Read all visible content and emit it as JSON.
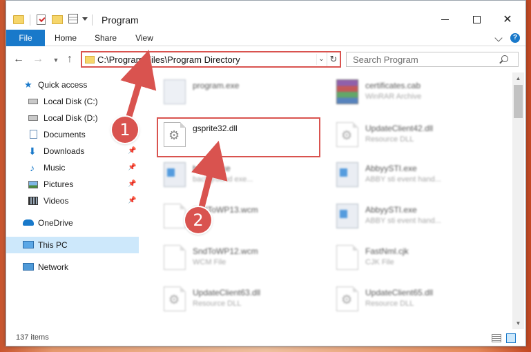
{
  "window": {
    "title": "Program"
  },
  "ribbon": {
    "tabs": [
      "File",
      "Home",
      "Share",
      "View"
    ],
    "help": "?"
  },
  "nav": {
    "address_path": "C:\\Program Files\\Program Directory",
    "search_placeholder": "Search Program"
  },
  "sidebar": {
    "items": [
      {
        "label": "Quick access",
        "icon": "star-icon",
        "pinned": false
      },
      {
        "label": "Local Disk (C:)",
        "icon": "drive-icon",
        "pinned": false
      },
      {
        "label": "Local Disk (D:)",
        "icon": "drive-icon",
        "pinned": false
      },
      {
        "label": "Documents",
        "icon": "documents-icon",
        "pinned": true
      },
      {
        "label": "Downloads",
        "icon": "download-icon",
        "pinned": true
      },
      {
        "label": "Music",
        "icon": "music-icon",
        "pinned": true
      },
      {
        "label": "Pictures",
        "icon": "pictures-icon",
        "pinned": true
      },
      {
        "label": "Videos",
        "icon": "videos-icon",
        "pinned": true
      },
      {
        "label": "OneDrive",
        "icon": "cloud-icon",
        "pinned": false
      },
      {
        "label": "This PC",
        "icon": "computer-icon",
        "pinned": false,
        "selected": true
      },
      {
        "label": "Network",
        "icon": "network-icon",
        "pinned": false
      }
    ]
  },
  "files": [
    {
      "name": "program.exe",
      "type": "",
      "icon": "program-icon"
    },
    {
      "name": "certificates.cab",
      "type": "WinRAR Archive",
      "icon": "archive-icon"
    },
    {
      "name": "gsprite32.dll",
      "type": "",
      "icon": "dll-icon"
    },
    {
      "name": "UpdateClient42.dll",
      "type": "Resource DLL",
      "icon": "dll-icon"
    },
    {
      "name": "bexec.exe",
      "type": "background exe...",
      "icon": "exe-icon"
    },
    {
      "name": "AbbyySTI.exe",
      "type": "ABBY sti event hand...",
      "icon": "exe-icon"
    },
    {
      "name": "SndToWP13.wcm",
      "type": "File",
      "icon": "file-icon"
    },
    {
      "name": "AbbyySTI.exe",
      "type": "ABBY sti event hand...",
      "icon": "exe-icon"
    },
    {
      "name": "SndToWP12.wcm",
      "type": "WCM File",
      "icon": "file-icon"
    },
    {
      "name": "FastNml.cjk",
      "type": "CJK File",
      "icon": "file-icon"
    },
    {
      "name": "UpdateClient63.dll",
      "type": "Resource DLL",
      "icon": "dll-icon"
    },
    {
      "name": "UpdateClient65.dll",
      "type": "Resource DLL",
      "icon": "dll-icon"
    }
  ],
  "status": {
    "item_count": "137 items"
  },
  "annotations": {
    "callout_1": "1",
    "callout_2": "2",
    "accent_color": "#d9534f"
  }
}
